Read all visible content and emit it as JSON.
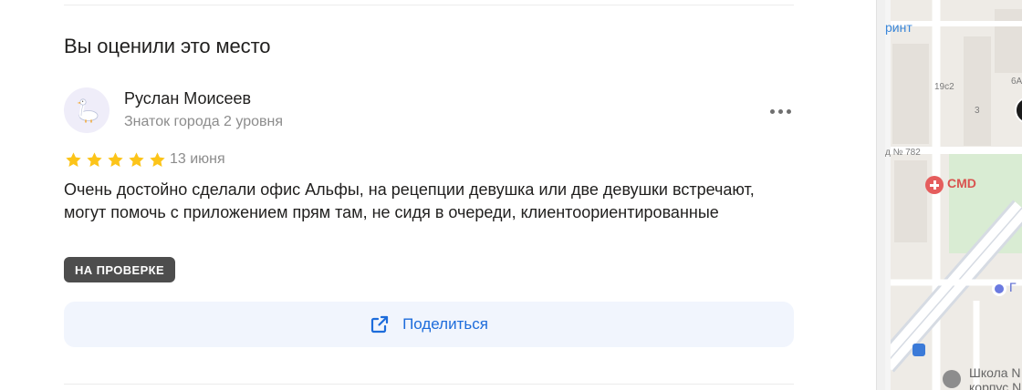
{
  "section": {
    "title": "Вы оценили это место"
  },
  "review": {
    "author_name": "Руслан Моисеев",
    "author_level": "Знаток города 2 уровня",
    "avatar_icon": "goose-avatar-icon",
    "rating": 5,
    "rating_max": 5,
    "date": "13 июня",
    "text": "Очень достойно сделали офис Альфы, на рецепции девушка или две девушки встречают, могут помочь с приложением прям там, не сидя в очереди, клиентоориентированные",
    "status_badge": "НА ПРОВЕРКЕ",
    "more_icon": "more-dots-icon"
  },
  "share": {
    "label": "Поделиться",
    "icon": "share-external-icon"
  },
  "map": {
    "labels": {
      "top": "ринт",
      "building_1": "19с2",
      "building_2": "6А",
      "building_3": "3",
      "street": "д № 782",
      "poi_red": "CMD",
      "poi_blue": "Г",
      "school_line1": "Школа N",
      "school_line2": "корпус N"
    }
  },
  "colors": {
    "accent": "#1d6cdb",
    "star": "#fcc419",
    "badge_bg": "#4d4d4d",
    "share_bg": "#f1f5fd"
  }
}
